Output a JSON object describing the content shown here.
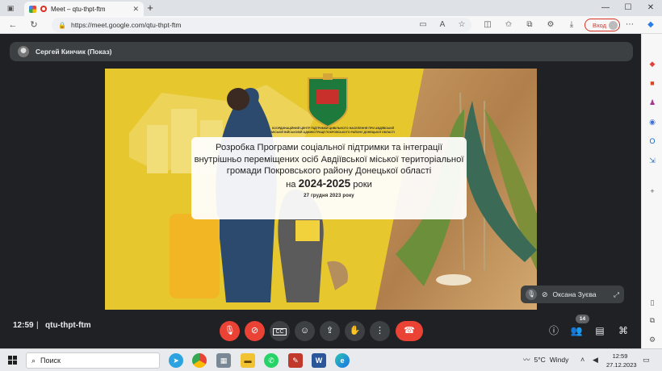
{
  "browser": {
    "tab_title": "Meet – qtu-thpt-ftm",
    "tab_close": "✕",
    "new_tab": "+",
    "window_min": "—",
    "window_max": "☐",
    "window_close": "✕",
    "url": "https://meet.google.com/qtu-thpt-ftm",
    "login_label": "Вход"
  },
  "meet": {
    "presenter_label": "Сергей Кинчик (Показ)",
    "time": "12:59",
    "separator": "|",
    "meeting_code": "qtu-thpt-ftm",
    "participant_name": "Оксана Зуєва",
    "participant_count": "14"
  },
  "slide": {
    "org_name": "КООРДИНАЦІЙНИЙ ЦЕНТР ПІДТРИМКИ ЦИВІЛЬНОГО НАСЕЛЕННЯ ПРИ АВДІЇВСЬКІЙ МІСЬКІЙ ВІЙСЬКОВІЙ АДМІНІСТРАЦІЇ ПОКРОВСЬКОГО РАЙОНУ ДОНЕЦЬКОЇ ОБЛАСТІ",
    "title": "Розробка Програми соціальної підтримки та інтеграції внутрішньо переміщених осіб Авдіївської міської територіальної громади Покровського району Донецької області",
    "years_prefix": "на",
    "years": "2024-2025",
    "years_suffix": "роки",
    "date": "27 грудня 2023 року"
  },
  "taskbar": {
    "search_label": "Поиск",
    "temperature": "5°C",
    "weather": "Windy",
    "time": "12:59",
    "date": "27.12.2023"
  },
  "colors": {
    "meet_bg": "#202124",
    "control_red": "#ea4335",
    "control_gray": "#3c4043",
    "slide_yellow": "#e6c72e"
  }
}
